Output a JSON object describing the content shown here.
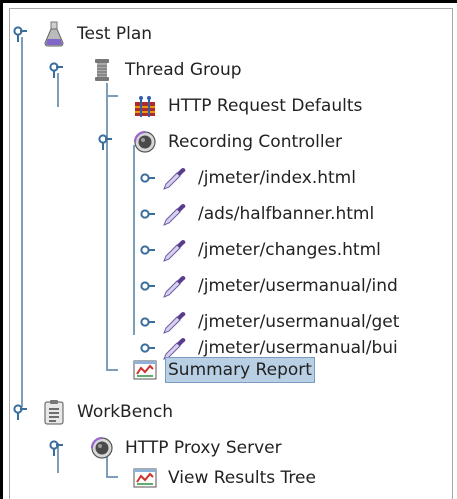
{
  "tree": {
    "nodes": [
      {
        "label": "Test Plan",
        "icon": "flask-icon",
        "level": 0,
        "expanded": true
      },
      {
        "label": "Thread Group",
        "icon": "spool-icon",
        "level": 1,
        "expanded": true
      },
      {
        "label": "HTTP Request Defaults",
        "icon": "config-grid-icon",
        "level": 2
      },
      {
        "label": "Recording Controller",
        "icon": "controller-icon",
        "level": 2,
        "expanded": true
      },
      {
        "label": "/jmeter/index.html",
        "icon": "pipette-icon",
        "level": 3
      },
      {
        "label": "/ads/halfbanner.html",
        "icon": "pipette-icon",
        "level": 3
      },
      {
        "label": "/jmeter/changes.html",
        "icon": "pipette-icon",
        "level": 3
      },
      {
        "label": "/jmeter/usermanual/ind",
        "icon": "pipette-icon",
        "level": 3
      },
      {
        "label": "/jmeter/usermanual/get",
        "icon": "pipette-icon",
        "level": 3
      },
      {
        "label": "/jmeter/usermanual/bui",
        "icon": "pipette-icon",
        "level": 3
      },
      {
        "label": "Summary Report",
        "icon": "report-icon",
        "level": 2,
        "selected": true
      },
      {
        "label": "WorkBench",
        "icon": "clipboard-icon",
        "level": 0,
        "expanded": true
      },
      {
        "label": "HTTP Proxy Server",
        "icon": "controller-icon",
        "level": 1,
        "expanded": true
      },
      {
        "label": "View Results Tree",
        "icon": "report-icon",
        "level": 2
      }
    ]
  },
  "colors": {
    "tree_line": "#7d9db8",
    "selection_bg": "#b9cfe4",
    "selection_border": "#7a9cc3",
    "text": "#222222"
  }
}
